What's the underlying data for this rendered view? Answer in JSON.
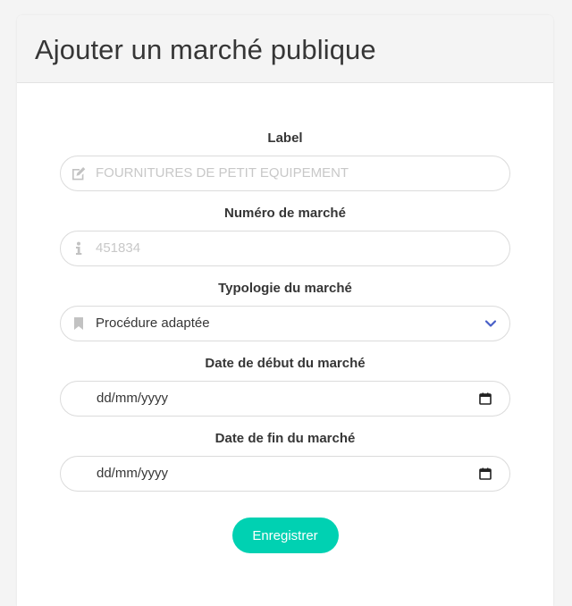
{
  "page": {
    "title": "Ajouter un marché publique"
  },
  "form": {
    "label_field": {
      "label": "Label",
      "placeholder": "FOURNITURES DE PETIT EQUIPEMENT",
      "icon": "edit-icon"
    },
    "numero_field": {
      "label": "Numéro de marché",
      "placeholder": "451834",
      "icon": "info-icon"
    },
    "typologie_field": {
      "label": "Typologie du marché",
      "value": "Procédure adaptée",
      "icon": "bookmark-icon"
    },
    "date_debut_field": {
      "label": "Date de début du marché",
      "value": "dd/mm/yyyy",
      "icon": "calendar-icon"
    },
    "date_fin_field": {
      "label": "Date de fin du marché",
      "value": "dd/mm/yyyy",
      "icon": "calendar-icon"
    },
    "submit_label": "Enregistrer"
  },
  "colors": {
    "accent": "#00d1b2",
    "chevron": "#485fc7",
    "header_bg": "#f4f4f4"
  }
}
